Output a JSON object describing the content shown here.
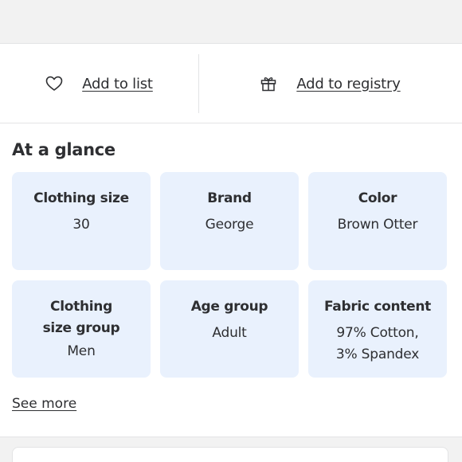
{
  "actions": {
    "add_to_list": "Add to list",
    "add_to_registry": "Add to registry",
    "list_icon": "heart-icon",
    "registry_icon": "gift-icon"
  },
  "glance": {
    "title": "At a glance",
    "cards": [
      {
        "key": "Clothing size",
        "value": "30"
      },
      {
        "key": "Brand",
        "value": "George"
      },
      {
        "key": "Color",
        "value": "Brown Otter"
      },
      {
        "key_line1": "Clothing",
        "key_line2": "size group",
        "value": "Men"
      },
      {
        "key": "Age group",
        "value": "Adult"
      },
      {
        "key": "Fabric content",
        "value_line1": "97% Cotton,",
        "value_line2": "3% Spandex"
      }
    ]
  },
  "see_more": "See more",
  "colors": {
    "card_bg": "#e9f1fd",
    "text": "#2e2f32",
    "divider": "#e3e4e5",
    "band": "#f2f2f2"
  }
}
